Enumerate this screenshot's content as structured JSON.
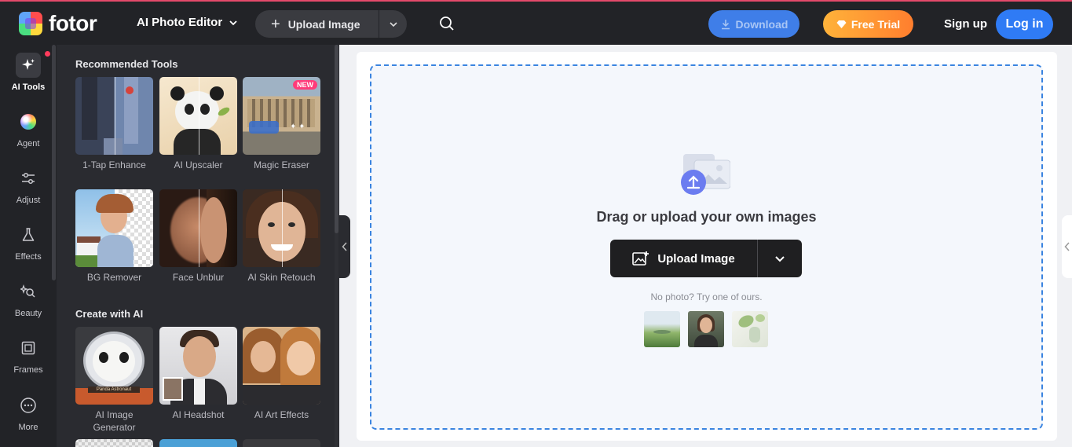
{
  "header": {
    "logo_text": "fotor",
    "editor_menu": "AI Photo Editor",
    "upload_label": "Upload Image",
    "download_label": "Download",
    "free_trial_label": "Free Trial",
    "signup_label": "Sign up",
    "login_label": "Log in"
  },
  "rail": {
    "items": [
      {
        "label": "AI Tools",
        "icon": "sparkle-icon"
      },
      {
        "label": "Agent",
        "icon": "color-orb-icon"
      },
      {
        "label": "Adjust",
        "icon": "sliders-icon"
      },
      {
        "label": "Effects",
        "icon": "flask-icon"
      },
      {
        "label": "Beauty",
        "icon": "sparkle-wand-icon"
      },
      {
        "label": "Frames",
        "icon": "frame-icon"
      },
      {
        "label": "More",
        "icon": "more-dots-icon"
      }
    ]
  },
  "panel": {
    "recommended_title": "Recommended Tools",
    "recommended": [
      {
        "label": "1-Tap Enhance"
      },
      {
        "label": "AI Upscaler"
      },
      {
        "label": "Magic Eraser",
        "badge": "NEW"
      },
      {
        "label": "BG Remover"
      },
      {
        "label": "Face Unblur"
      },
      {
        "label": "AI Skin Retouch"
      }
    ],
    "create_title": "Create with AI",
    "create": [
      {
        "label": "AI Image Generator",
        "caption": "Panda Astronaut"
      },
      {
        "label": "AI Headshot"
      },
      {
        "label": "AI Art Effects"
      }
    ]
  },
  "canvas": {
    "title": "Drag or upload your own images",
    "upload_label": "Upload Image",
    "hint": "No photo? Try one of ours."
  },
  "colors": {
    "accent_blue": "#2f7bf5",
    "dashed_border": "#3a84e0",
    "trial_orange": "#ff9a34",
    "dark_bg": "#222327"
  }
}
